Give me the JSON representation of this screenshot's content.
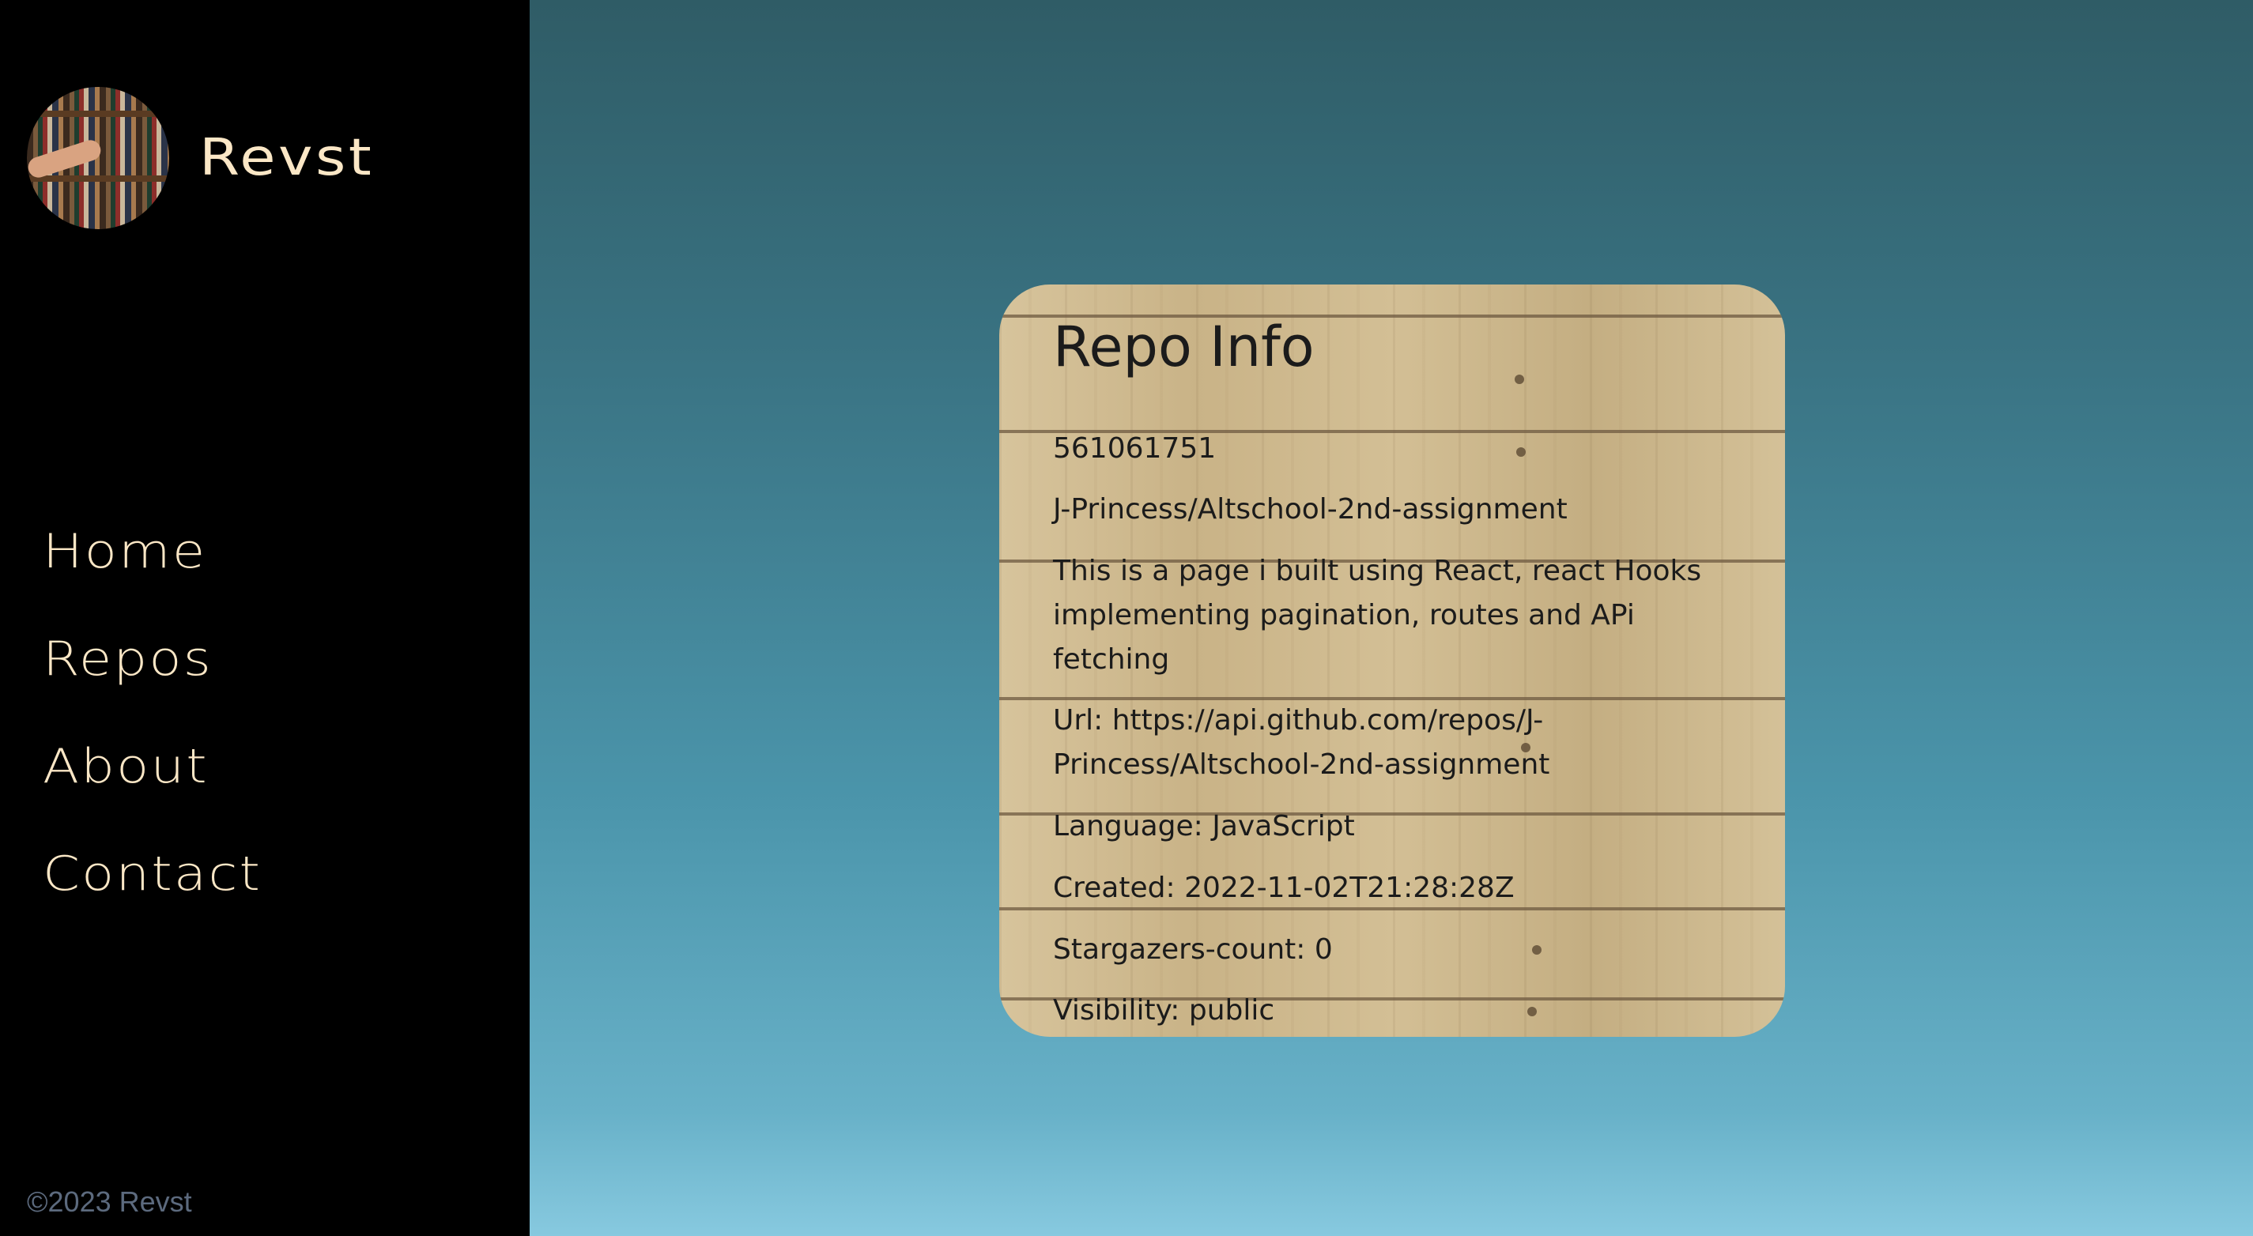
{
  "sidebar": {
    "brand": {
      "name": "Revst"
    },
    "nav": [
      {
        "label": "Home"
      },
      {
        "label": "Repos"
      },
      {
        "label": "About"
      },
      {
        "label": "Contact"
      }
    ],
    "footer": "©2023 Revst"
  },
  "repo_card": {
    "title": "Repo Info",
    "id": "561061751",
    "full_name": "J-Princess/Altschool-2nd-assignment",
    "description": "This is a page i built using React, react Hooks implementing pagination, routes and APi fetching",
    "url_label": "Url:",
    "url": "https://api.github.com/repos/J-Princess/Altschool-2nd-assignment",
    "language_label": "Language:",
    "language": "JavaScript",
    "created_label": "Created:",
    "created": "2022-11-02T21:28:28Z",
    "stargazers_label": "Stargazers-count:",
    "stargazers": "0",
    "visibility_label": "Visibility:",
    "visibility": "public"
  },
  "colors": {
    "sidebar_bg": "#000000",
    "nav_text": "#fbe7c6",
    "footer_text": "#5c6a7e",
    "card_text": "#1b1b1b",
    "background_top": "#2f5c66",
    "background_bottom": "#87c9df"
  },
  "icons": {
    "avatar": "bookshelf-photo-avatar"
  }
}
